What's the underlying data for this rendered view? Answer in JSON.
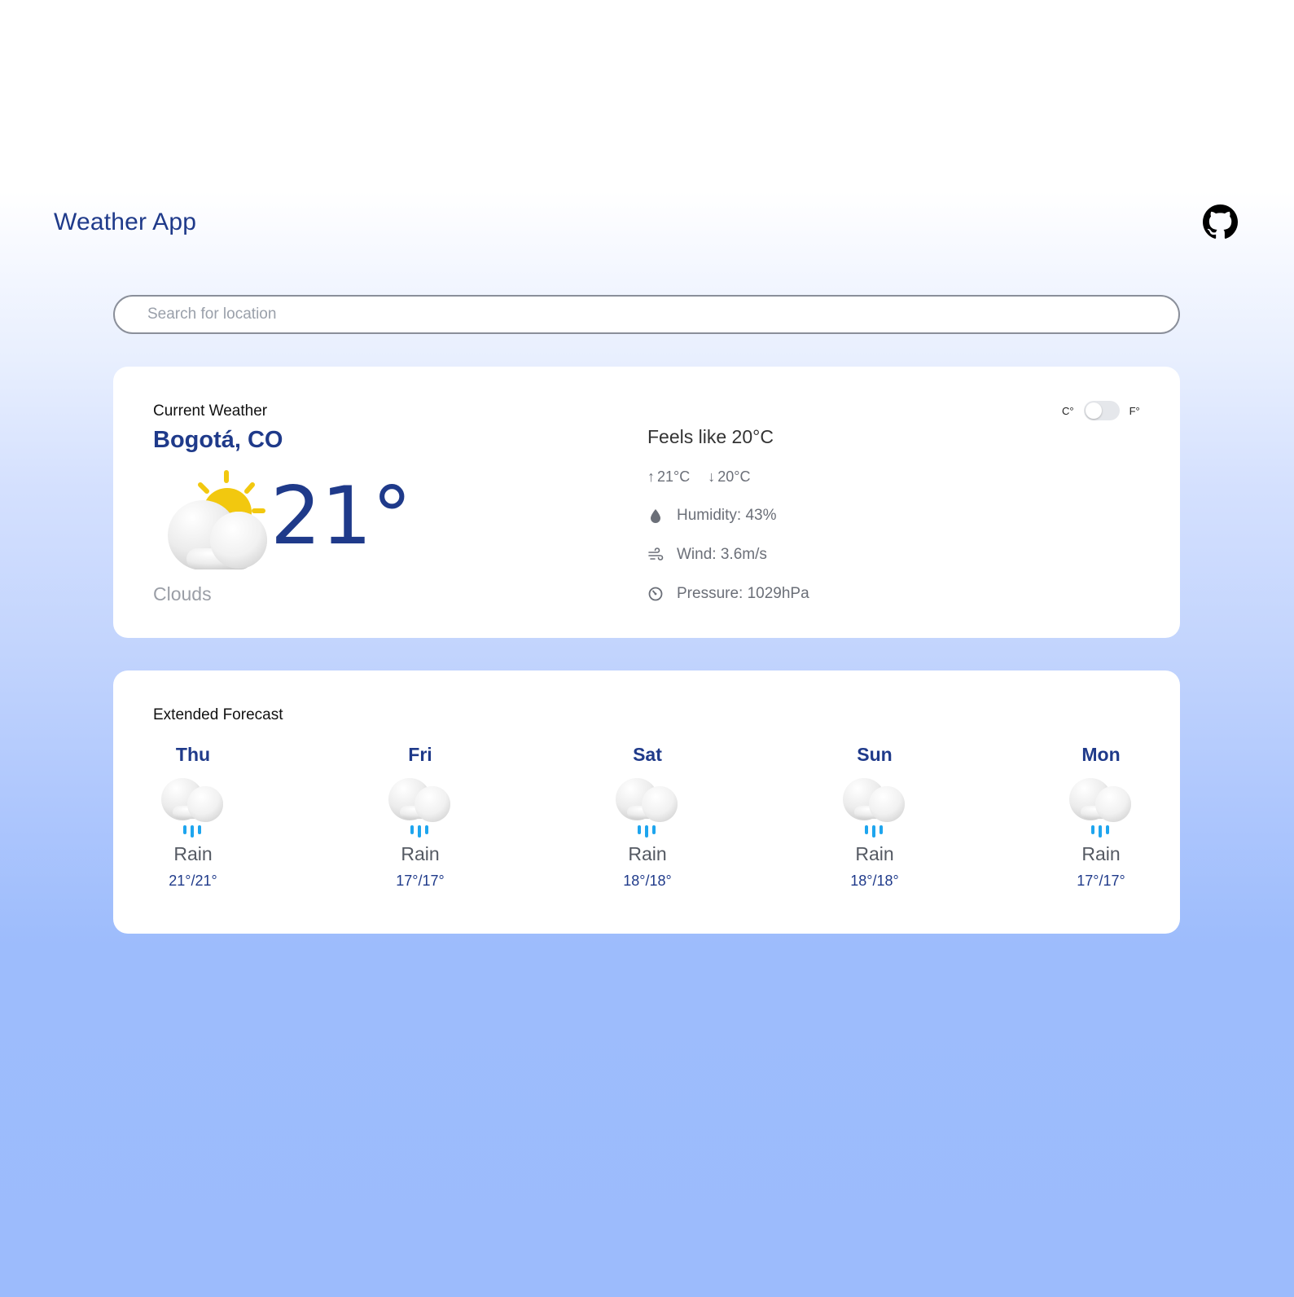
{
  "header": {
    "title": "Weather App",
    "github_icon": "github-icon"
  },
  "search": {
    "placeholder": "Search for location",
    "value": ""
  },
  "current": {
    "section_title": "Current Weather",
    "location": "Bogotá, CO",
    "temperature": "21°",
    "condition": "Clouds",
    "icon": "partly-cloudy-icon",
    "feels_like": "Feels like 20°C",
    "temp_max": "21°C",
    "temp_min": "20°C",
    "humidity": "Humidity: 43%",
    "wind": "Wind: 3.6m/s",
    "pressure": "Pressure: 1029hPa",
    "unit_toggle": {
      "celsius_label": "C°",
      "fahrenheit_label": "F°",
      "selected": "C°"
    }
  },
  "forecast": {
    "section_title": "Extended Forecast",
    "days": [
      {
        "day": "Thu",
        "condition": "Rain",
        "temps": "21°/21°",
        "icon": "rain-icon"
      },
      {
        "day": "Fri",
        "condition": "Rain",
        "temps": "17°/17°",
        "icon": "rain-icon"
      },
      {
        "day": "Sat",
        "condition": "Rain",
        "temps": "18°/18°",
        "icon": "rain-icon"
      },
      {
        "day": "Sun",
        "condition": "Rain",
        "temps": "18°/18°",
        "icon": "rain-icon"
      },
      {
        "day": "Mon",
        "condition": "Rain",
        "temps": "17°/17°",
        "icon": "rain-icon"
      }
    ]
  },
  "colors": {
    "accent": "#1f3a8a",
    "sun": "#f2c80f",
    "rain": "#1ea5ee",
    "muted": "#6b6f78"
  }
}
